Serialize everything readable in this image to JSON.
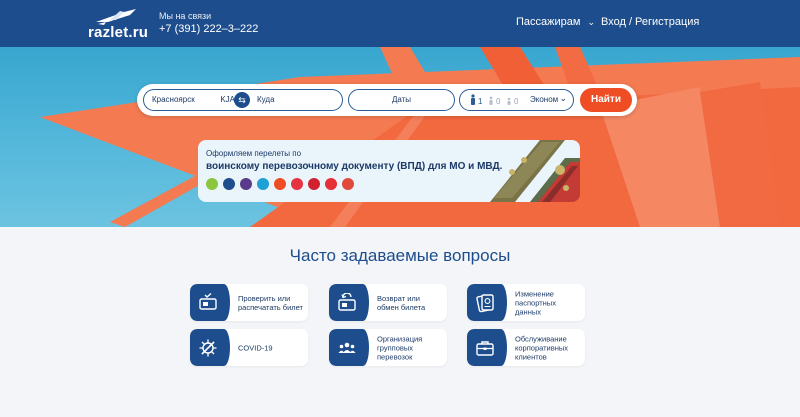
{
  "header": {
    "logo_text": "razlet.ru",
    "contact_label": "Мы на связи",
    "phone": "+7 (391) 222–3–222",
    "nav_passengers": "Пассажирам",
    "nav_login": "Вход / Регистрация"
  },
  "search": {
    "from_city": "Красноярск",
    "from_code": "KJA",
    "to_placeholder": "Куда",
    "dates_placeholder": "Даты",
    "adults": "1",
    "children": "0",
    "infants": "0",
    "travel_class": "Эконом",
    "find_label": "Найти"
  },
  "promo": {
    "small_text": "Оформляем перелеты по",
    "big_text": "воинскому перевозочному документу (ВПД) для МО и МВД.",
    "airlines": [
      {
        "icon": "s7-logo",
        "color": "#8cc63f"
      },
      {
        "icon": "airline-logo",
        "color": "#1d4d8c"
      },
      {
        "icon": "airline-logo",
        "color": "#5b3a8c"
      },
      {
        "icon": "airline-logo",
        "color": "#1da1d6"
      },
      {
        "icon": "airline-logo",
        "color": "#ef4d24"
      },
      {
        "icon": "airline-logo",
        "color": "#e63340"
      },
      {
        "icon": "airline-logo",
        "color": "#d1202f"
      },
      {
        "icon": "airline-logo",
        "color": "#e5303a"
      },
      {
        "icon": "airline-logo",
        "color": "#e04a3c"
      }
    ]
  },
  "faq": {
    "title": "Часто задаваемые вопросы",
    "items": [
      {
        "label": "Проверить или распечатать билет",
        "icon": "ticket-check-icon"
      },
      {
        "label": "Возврат или обмен билета",
        "icon": "ticket-return-icon"
      },
      {
        "label": "Изменение паспортных данных",
        "icon": "passport-icon"
      },
      {
        "label": "COVID-19",
        "icon": "virus-icon"
      },
      {
        "label": "Организация групповых перевозок",
        "icon": "group-icon"
      },
      {
        "label": "Обслуживание корпоративных клиентов",
        "icon": "briefcase-icon"
      }
    ]
  },
  "colors": {
    "header_bg": "#1d4d8c",
    "accent": "#ef4d24",
    "sky": "#4bb1d8"
  }
}
